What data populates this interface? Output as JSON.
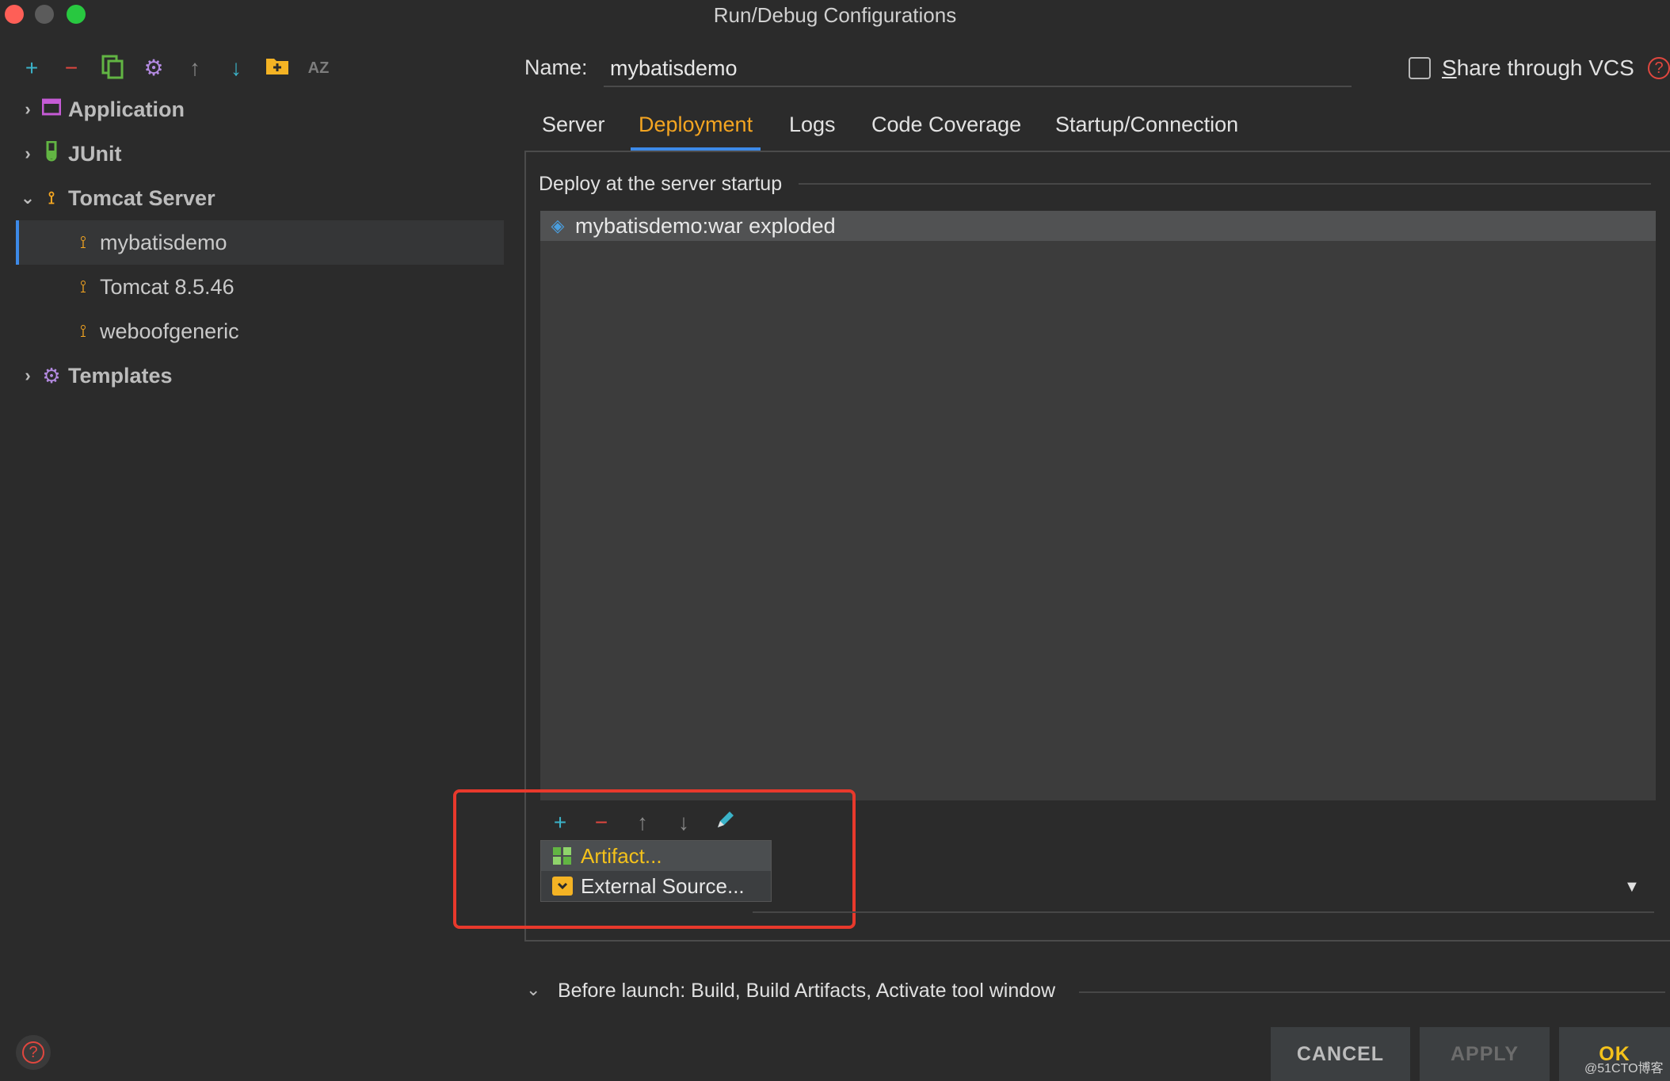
{
  "window": {
    "title": "Run/Debug Configurations"
  },
  "toolbar": {
    "icons": [
      "add-icon",
      "remove-icon",
      "copy-icon",
      "settings-icon",
      "move-up-icon",
      "move-down-icon",
      "folder-add-icon",
      "sort-az-icon"
    ],
    "sort_label": "AZ"
  },
  "tree": {
    "application": "Application",
    "junit": "JUnit",
    "tomcat_server": "Tomcat Server",
    "mybatisdemo": "mybatisdemo",
    "tomcat_version": "Tomcat 8.5.46",
    "weboofgeneric": "weboofgeneric",
    "templates": "Templates"
  },
  "name_field": {
    "label": "Name:",
    "value": "mybatisdemo"
  },
  "share_vcs": {
    "label_first": "S",
    "label_rest": "hare through VCS",
    "checked": false
  },
  "tabs": [
    "Server",
    "Deployment",
    "Logs",
    "Code Coverage",
    "Startup/Connection"
  ],
  "active_tab": "Deployment",
  "deployment": {
    "section_title": "Deploy at the server startup",
    "items": [
      "mybatisdemo:war exploded"
    ]
  },
  "popup": {
    "items": [
      "Artifact...",
      "External Source..."
    ]
  },
  "before_launch": "Before launch: Build, Build Artifacts, Activate tool window",
  "buttons": {
    "cancel": "CANCEL",
    "apply": "APPLY",
    "ok": "OK"
  },
  "watermark": "@51CTO博客",
  "colors": {
    "accent_tab": "#f4a521",
    "tab_underline": "#3d8ae8",
    "highlight_frame": "#e8392c",
    "ok_text": "#f4c21b",
    "add_icon": "#3bb3c9",
    "remove_icon": "#e0473f"
  }
}
